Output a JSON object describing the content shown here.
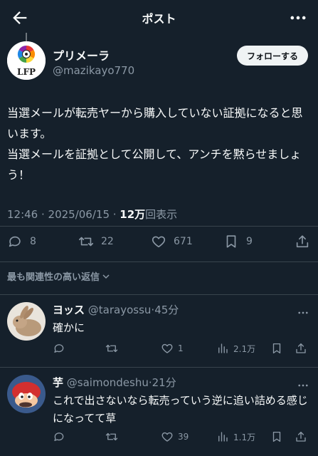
{
  "header": {
    "title": "ポスト",
    "back_icon": "arrow-left-icon",
    "more_icon": "more-horizontal-icon"
  },
  "author": {
    "name": "プリメーラ",
    "handle": "@mazikayo770",
    "avatar_logo_text": "LFP",
    "follow_label": "フォローする"
  },
  "post": {
    "text": "当選メールが転売ヤーから購入していない証拠になると思います。\n当選メールを証拠として公開して、アンチを黙らせましょう！",
    "time_date": "12:46 · 2025/06/15 · ",
    "views_count": "12万",
    "views_label": "回表示"
  },
  "actions": {
    "replies": "8",
    "reposts": "22",
    "likes": "671",
    "bookmarks": "9"
  },
  "sort": {
    "label": "最も関連性の高い返信"
  },
  "replies": [
    {
      "name": "ヨッス",
      "handle": "@tarayossu",
      "time": "45分",
      "text": "確かに",
      "replies": "",
      "reposts": "",
      "likes": "1",
      "views": "2.1万"
    },
    {
      "name": "芋",
      "handle": "@saimondeshu",
      "time": "21分",
      "text": "これで出さないなら転売っていう逆に追い詰める感じになってて草",
      "replies": "",
      "reposts": "",
      "likes": "39",
      "views": "1.1万"
    }
  ],
  "colors": {
    "background": "#15202b",
    "text": "#f7f9f9",
    "secondary": "#8b98a5",
    "divider": "#38444d"
  }
}
